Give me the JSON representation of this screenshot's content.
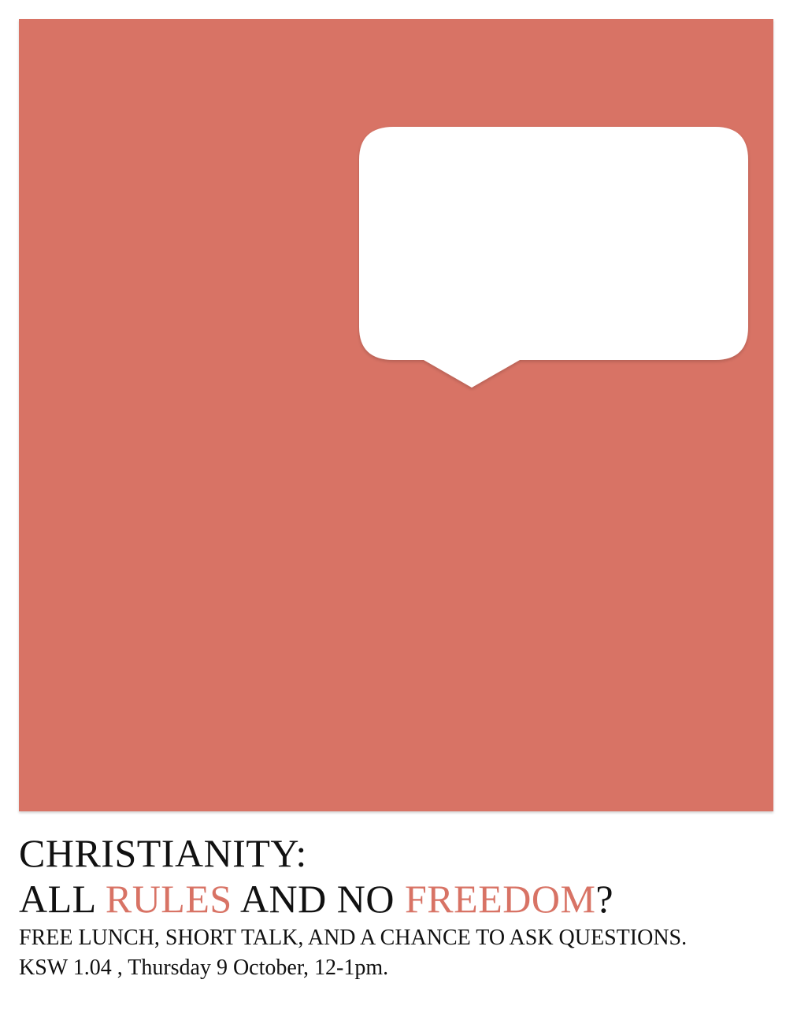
{
  "colors": {
    "panel": "#d87365",
    "accent": "#d87365",
    "text": "#111111",
    "bubble": "#ffffff"
  },
  "poster": {
    "icon": "speech-bubble-icon"
  },
  "headline": {
    "line1": "CHRISTIANITY:",
    "line2_part1": "ALL ",
    "line2_accent1": "RULES",
    "line2_part2": " AND NO ",
    "line2_accent2": "FREEDOM",
    "line2_part3": "?"
  },
  "details": {
    "line1": "FREE LUNCH, SHORT TALK, AND A CHANCE TO ASK QUESTIONS.",
    "line2": "KSW 1.04 , Thursday  9 October, 12-1pm."
  }
}
